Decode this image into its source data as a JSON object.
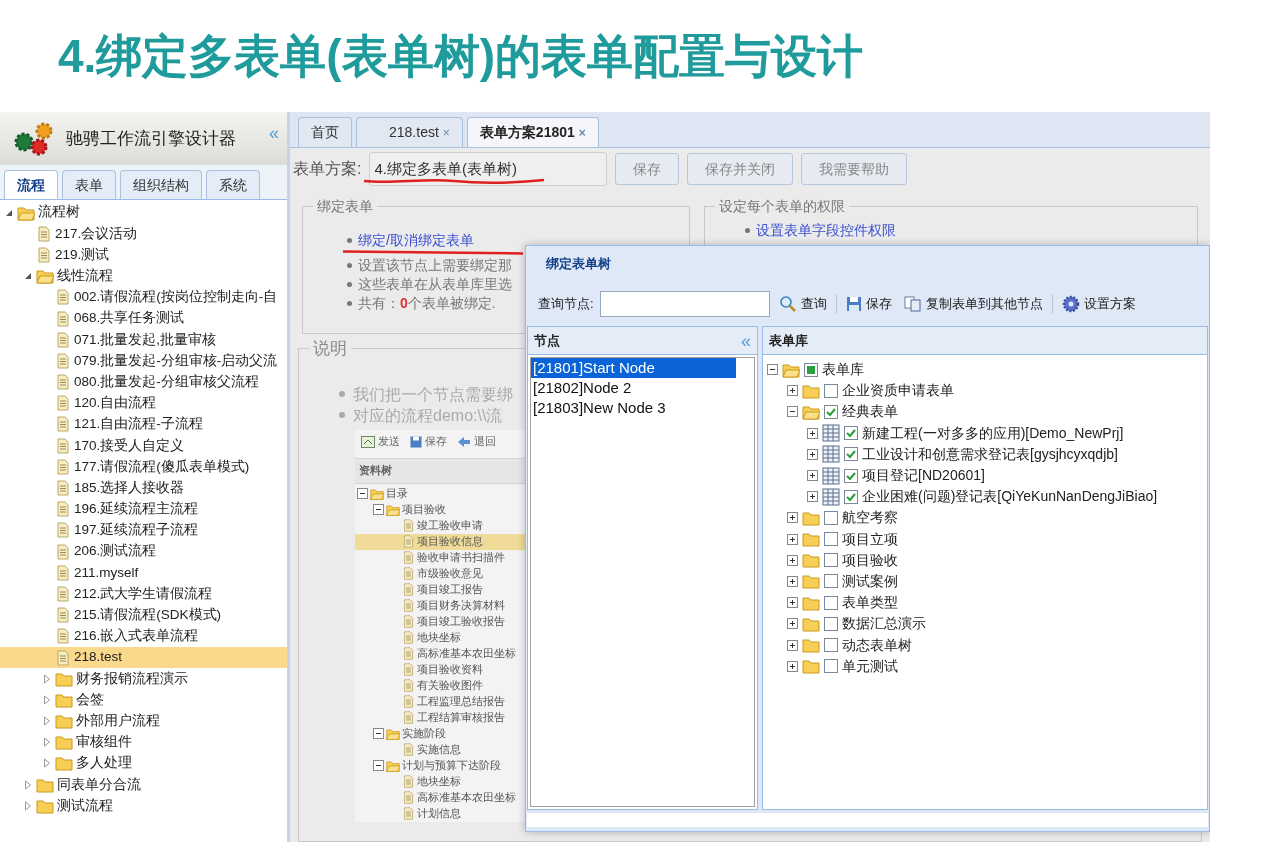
{
  "slide_title": "4.绑定多表单(表单树)的表单配置与设计",
  "sidebar": {
    "app_title": "驰骋工作流引擎设计器",
    "tabs": [
      {
        "label": "流程",
        "selected": true
      },
      {
        "label": "表单",
        "selected": false
      },
      {
        "label": "组织结构",
        "selected": false
      },
      {
        "label": "系统",
        "selected": false
      }
    ],
    "tree": [
      {
        "label": "流程树",
        "kind": "folder",
        "expanded": true,
        "selected": false,
        "children": [
          {
            "label": "217.会议活动",
            "kind": "file",
            "selected": false
          },
          {
            "label": "219.测试",
            "kind": "file",
            "selected": false
          },
          {
            "label": "线性流程",
            "kind": "folder",
            "expanded": true,
            "selected": false,
            "children": [
              {
                "label": "002.请假流程(按岗位控制走向-自",
                "kind": "file",
                "selected": false
              },
              {
                "label": "068.共享任务测试",
                "kind": "file",
                "selected": false
              },
              {
                "label": "071.批量发起,批量审核",
                "kind": "file",
                "selected": false
              },
              {
                "label": "079.批量发起-分组审核-启动父流",
                "kind": "file",
                "selected": false
              },
              {
                "label": "080.批量发起-分组审核父流程",
                "kind": "file",
                "selected": false
              },
              {
                "label": "120.自由流程",
                "kind": "file",
                "selected": false
              },
              {
                "label": "121.自由流程-子流程",
                "kind": "file",
                "selected": false
              },
              {
                "label": "170.接受人自定义",
                "kind": "file",
                "selected": false
              },
              {
                "label": "177.请假流程(傻瓜表单模式)",
                "kind": "file",
                "selected": false
              },
              {
                "label": "185.选择人接收器",
                "kind": "file",
                "selected": false
              },
              {
                "label": "196.延续流程主流程",
                "kind": "file",
                "selected": false
              },
              {
                "label": "197.延续流程子流程",
                "kind": "file",
                "selected": false
              },
              {
                "label": "206.测试流程",
                "kind": "file",
                "selected": false
              },
              {
                "label": "211.myself",
                "kind": "file",
                "selected": false
              },
              {
                "label": "212.武大学生请假流程",
                "kind": "file",
                "selected": false
              },
              {
                "label": "215.请假流程(SDK模式)",
                "kind": "file",
                "selected": false
              },
              {
                "label": "216.嵌入式表单流程",
                "kind": "file",
                "selected": false
              },
              {
                "label": "218.test",
                "kind": "file",
                "selected": true
              },
              {
                "label": "财务报销流程演示",
                "kind": "folder",
                "expanded": false,
                "selected": false
              },
              {
                "label": "会签",
                "kind": "folder",
                "expanded": false,
                "selected": false
              },
              {
                "label": "外部用户流程",
                "kind": "folder",
                "expanded": false,
                "selected": false
              },
              {
                "label": "审核组件",
                "kind": "folder",
                "expanded": false,
                "selected": false
              },
              {
                "label": "多人处理",
                "kind": "folder",
                "expanded": false,
                "selected": false
              }
            ]
          },
          {
            "label": "同表单分合流",
            "kind": "folder",
            "expanded": false,
            "selected": false
          },
          {
            "label": "测试流程",
            "kind": "folder",
            "expanded": false,
            "selected": false
          }
        ]
      }
    ]
  },
  "main": {
    "tabs": [
      {
        "label": "首页",
        "closable": false,
        "selected": false
      },
      {
        "label": "218.test",
        "closable": true,
        "selected": false
      },
      {
        "label": "表单方案21801",
        "closable": true,
        "selected": true
      }
    ],
    "close_mark": "×",
    "scheme_label": "表单方案:",
    "scheme_value": "4.绑定多表单(表单树)",
    "buttons": [
      "保存",
      "保存并关闭",
      "我需要帮助"
    ],
    "bind_section": {
      "legend": "绑定表单",
      "link": "绑定/取消绑定表单",
      "lines": [
        "设置该节点上需要绑定那",
        "这些表单在从表单库里选"
      ],
      "count_prefix": "共有：",
      "count": "0",
      "count_suffix": "个表单被绑定."
    },
    "permission_section": {
      "legend": "设定每个表单的权限",
      "link": "设置表单字段控件权限"
    },
    "notes_section": {
      "legend": "说明",
      "lines": [
        "我们把一个节点需要绑",
        "对应的流程demo:\\\\流"
      ]
    },
    "embedded": {
      "toolbar": [
        "发送",
        "保存",
        "退回"
      ],
      "tree_title": "资料树",
      "tree": [
        {
          "label": "目录",
          "kind": "folder",
          "expanded": true,
          "selected": false,
          "children": [
            {
              "label": "项目验收",
              "kind": "folder",
              "expanded": true,
              "selected": false,
              "children": [
                {
                  "label": "竣工验收申请",
                  "kind": "file",
                  "selected": false
                },
                {
                  "label": "项目验收信息",
                  "kind": "file",
                  "selected": true
                },
                {
                  "label": "验收申请书扫描件",
                  "kind": "file",
                  "selected": false
                },
                {
                  "label": "市级验收意见",
                  "kind": "file",
                  "selected": false
                },
                {
                  "label": "项目竣工报告",
                  "kind": "file",
                  "selected": false
                },
                {
                  "label": "项目财务决算材料",
                  "kind": "file",
                  "selected": false
                },
                {
                  "label": "项目竣工验收报告",
                  "kind": "file",
                  "selected": false
                },
                {
                  "label": "地块坐标",
                  "kind": "file",
                  "selected": false
                },
                {
                  "label": "高标准基本农田坐标",
                  "kind": "file",
                  "selected": false
                },
                {
                  "label": "项目验收资料",
                  "kind": "file",
                  "selected": false
                },
                {
                  "label": "有关验收图件",
                  "kind": "file",
                  "selected": false
                },
                {
                  "label": "工程监理总结报告",
                  "kind": "file",
                  "selected": false
                },
                {
                  "label": "工程结算审核报告",
                  "kind": "file",
                  "selected": false
                }
              ]
            },
            {
              "label": "实施阶段",
              "kind": "folder",
              "expanded": true,
              "selected": false,
              "children": [
                {
                  "label": "实施信息",
                  "kind": "file",
                  "selected": false
                }
              ]
            },
            {
              "label": "计划与预算下达阶段",
              "kind": "folder",
              "expanded": true,
              "selected": false,
              "children": [
                {
                  "label": "地块坐标",
                  "kind": "file",
                  "selected": false
                },
                {
                  "label": "高标准基本农田坐标",
                  "kind": "file",
                  "selected": false
                },
                {
                  "label": "计划信息",
                  "kind": "file",
                  "selected": false
                }
              ]
            }
          ]
        }
      ]
    }
  },
  "dialog": {
    "title": "绑定表单树",
    "search_label": "查询节点:",
    "toolbar": [
      {
        "kind": "search",
        "label": "查询"
      },
      {
        "kind": "save",
        "label": "保存"
      },
      {
        "kind": "copy",
        "label": "复制表单到其他节点"
      },
      {
        "kind": "settings",
        "label": "设置方案"
      }
    ],
    "nodes_title": "节点",
    "collapse_mark": "«",
    "nodes": [
      {
        "label": "[21801]Start Node",
        "selected": true
      },
      {
        "label": "[21802]Node 2",
        "selected": false
      },
      {
        "label": "[21803]New Node 3",
        "selected": false
      }
    ],
    "library_title": "表单库",
    "library": [
      {
        "label": "表单库",
        "kind": "folder",
        "expanded": true,
        "checked": false,
        "partial": true,
        "children": [
          {
            "label": "企业资质申请表单",
            "kind": "folder",
            "expanded": false,
            "checked": false,
            "partial": false
          },
          {
            "label": "经典表单",
            "kind": "folder",
            "expanded": true,
            "checked": true,
            "partial": false,
            "children": [
              {
                "label": "新建工程(一对多多的应用)[Demo_NewPrj]",
                "kind": "table",
                "expanded": false,
                "checked": true,
                "partial": false
              },
              {
                "label": "工业设计和创意需求登记表[gysjhcyxqdjb]",
                "kind": "table",
                "expanded": false,
                "checked": true,
                "partial": false
              },
              {
                "label": "项目登记[ND20601]",
                "kind": "table",
                "expanded": false,
                "checked": true,
                "partial": false
              },
              {
                "label": "企业困难(问题)登记表[QiYeKunNanDengJiBiao]",
                "kind": "table",
                "expanded": false,
                "checked": true,
                "partial": false
              }
            ]
          },
          {
            "label": "航空考察",
            "kind": "folder",
            "expanded": false,
            "checked": false,
            "partial": false
          },
          {
            "label": "项目立项",
            "kind": "folder",
            "expanded": false,
            "checked": false,
            "partial": false
          },
          {
            "label": "项目验收",
            "kind": "folder",
            "expanded": false,
            "checked": false,
            "partial": false
          },
          {
            "label": "测试案例",
            "kind": "folder",
            "expanded": false,
            "checked": false,
            "partial": false
          },
          {
            "label": "表单类型",
            "kind": "folder",
            "expanded": false,
            "checked": false,
            "partial": false
          },
          {
            "label": "数据汇总演示",
            "kind": "folder",
            "expanded": false,
            "checked": false,
            "partial": false
          },
          {
            "label": "动态表单树",
            "kind": "folder",
            "expanded": false,
            "checked": false,
            "partial": false
          },
          {
            "label": "单元测试",
            "kind": "folder",
            "expanded": false,
            "checked": false,
            "partial": false
          }
        ]
      }
    ]
  }
}
